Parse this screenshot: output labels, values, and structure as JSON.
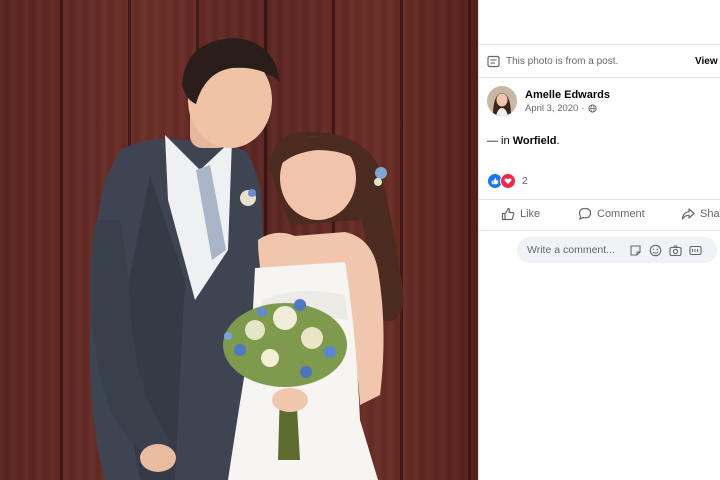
{
  "post": {
    "notice_text": "This photo is from a post.",
    "view_link": "View",
    "author_name": "Amelle Edwards",
    "date": "April 3, 2020",
    "privacy_icon": "globe-icon",
    "checkin_prefix": "— in",
    "location": "Worfield",
    "checkin_suffix": ".",
    "reaction_count": "2",
    "reaction_icons": [
      "like-reaction-icon",
      "love-reaction-icon"
    ]
  },
  "actions": {
    "like": "Like",
    "comment": "Comment",
    "share": "Share"
  },
  "comment": {
    "placeholder": "Write a comment...",
    "tool_icons": [
      "sticker-icon",
      "emoji-icon",
      "camera-icon",
      "gif-icon"
    ]
  },
  "colors": {
    "accent": "#1877f2",
    "love": "#f0284a",
    "secondary_text": "#65676b",
    "divider": "#e4e6eb"
  }
}
